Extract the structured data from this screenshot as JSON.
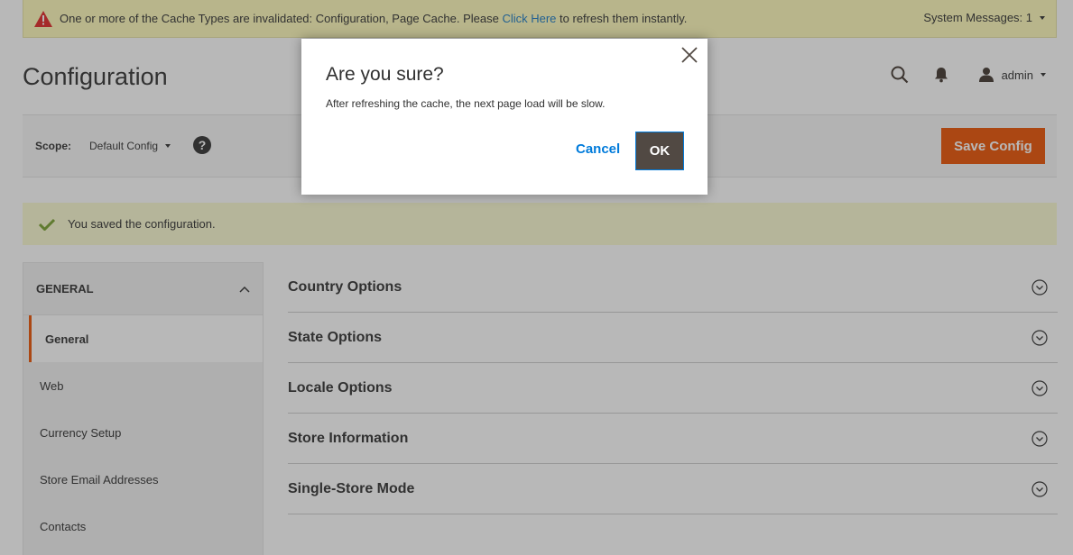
{
  "system_message": {
    "text_before": "One or more of the Cache Types are invalidated: Configuration, Page Cache. Please ",
    "link": "Click Here",
    "text_after": " to refresh them instantly.",
    "count_label": "System Messages: 1",
    "icon": "warning-triangle-icon"
  },
  "header": {
    "title": "Configuration",
    "user": "admin"
  },
  "scope": {
    "label": "Scope:",
    "value": "Default Config",
    "help": "?"
  },
  "toolbar": {
    "save_label": "Save Config"
  },
  "messages": {
    "success": "You saved the configuration."
  },
  "sidebar": {
    "heading": "GENERAL",
    "items": [
      {
        "label": "General",
        "active": true
      },
      {
        "label": "Web"
      },
      {
        "label": "Currency Setup"
      },
      {
        "label": "Store Email Addresses"
      },
      {
        "label": "Contacts"
      }
    ]
  },
  "sections": [
    {
      "label": "Country Options"
    },
    {
      "label": "State Options"
    },
    {
      "label": "Locale Options"
    },
    {
      "label": "Store Information"
    },
    {
      "label": "Single-Store Mode"
    }
  ],
  "modal": {
    "title": "Are you sure?",
    "text": "After refreshing the cache, the next page load will be slow.",
    "cancel": "Cancel",
    "ok": "OK"
  },
  "colors": {
    "accent": "#eb5202",
    "link": "#1979c3",
    "ok_button": "#514943",
    "warning_bg": "#fffbbb",
    "success_bg": "#fafad1"
  }
}
